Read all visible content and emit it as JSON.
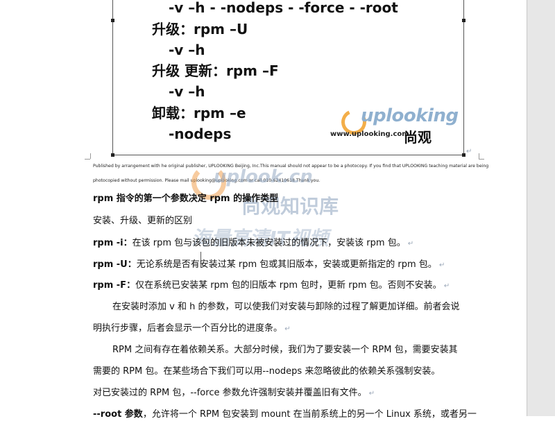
{
  "slide": {
    "lines": [
      "-v –h  - -nodeps  - -force  - -root",
      "升级：rpm –U",
      "-v –h",
      "升级 更新：rpm –F",
      "-v –h",
      "卸载：rpm –e",
      "-nodeps"
    ],
    "logo": {
      "brand": "uplooking",
      "url": "www.uplooking.com",
      "cn": "尚观"
    }
  },
  "notice": {
    "line1": "Published by arrangement with he original publisher, UPLOOKING Beijing, Inc.This manual should not appear to be a photocopy. If you find that UPLOOKING teaching material are being",
    "line2": "photocopied without permission. Please mail uplooking@uplooking.com or call 010-62410618 Thank you."
  },
  "watermark": {
    "brand": "uplook.cn",
    "cn_name": "尚观知识库",
    "slogan": "海量高清IT视频"
  },
  "body": {
    "heading": "rpm 指令的第一个参数决定 rpm 的操作类型",
    "subheading": "安装、升级、更新的区别",
    "items": [
      {
        "key": "rpm -i：",
        "text": "在该 rpm 包与该包的旧版本未被安装过的情况下，安装该 rpm 包。"
      },
      {
        "key": "rpm -U：",
        "text": "无论系统是否有安装过某 rpm 包或其旧版本，安装或更新指定的 rpm 包。"
      },
      {
        "key": "rpm -F：",
        "text": "仅在系统已安装某 rpm 包的旧版本 rpm 包时，更新 rpm 包。否则不安装。"
      }
    ],
    "para1_l1": "在安装时添加 v 和 h 的参数，可以使我们对安装与卸除的过程了解更加详细。前者会说",
    "para1_l2": "明执行步骤，后者会显示一个百分比的进度条。",
    "para2_l1": "RPM 之间有存在着依赖关系。大部分时候，我们为了要安装一个 RPM 包，需要安装其",
    "para2_l2": "需要的 RPM 包。在某些场合下我们可以用--nodeps 来忽略彼此的依赖关系强制安装。",
    "para3": "对已安装过的 RPM 包，--force 参数允许强制安装并覆盖旧有文件。",
    "para4_key": "--root 参数",
    "para4_text": "，允许将一个 RPM 包安装到 mount 在当前系统上的另一个 Linux 系统，或者另一"
  }
}
